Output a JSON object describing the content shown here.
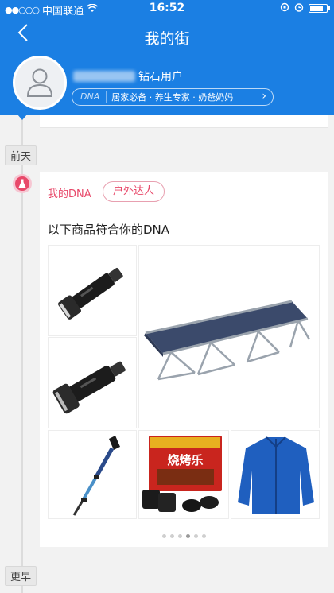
{
  "status_bar": {
    "carrier": "中国联通",
    "signal_dots": "●●○○○",
    "time": "16:52",
    "battery_level": 0.85
  },
  "header": {
    "title": "我的街",
    "back_icon": "chevron-left-icon",
    "username_suffix": "钻石用户",
    "dna_label": "DNA",
    "dna_tags": "居家必备 · 养生专家 · 奶爸奶妈",
    "dna_chevron": "›"
  },
  "timeline": {
    "day_label": "前天",
    "earlier_label": "更早"
  },
  "card": {
    "my_dna": "我的DNA",
    "dna_type": "户外达人",
    "subtitle": "以下商品符合你的DNA",
    "products": [
      {
        "name": "flashlight-1"
      },
      {
        "name": "flashlight-2"
      },
      {
        "name": "folding-cot"
      },
      {
        "name": "trekking-pole"
      },
      {
        "name": "charcoal-box",
        "box_text": "烧烤乐"
      },
      {
        "name": "blue-fleece-jacket"
      }
    ],
    "page_count": 6,
    "active_page": 3
  },
  "colors": {
    "brand_blue": "#1b7fe3",
    "accent_pink": "#e8496a"
  }
}
